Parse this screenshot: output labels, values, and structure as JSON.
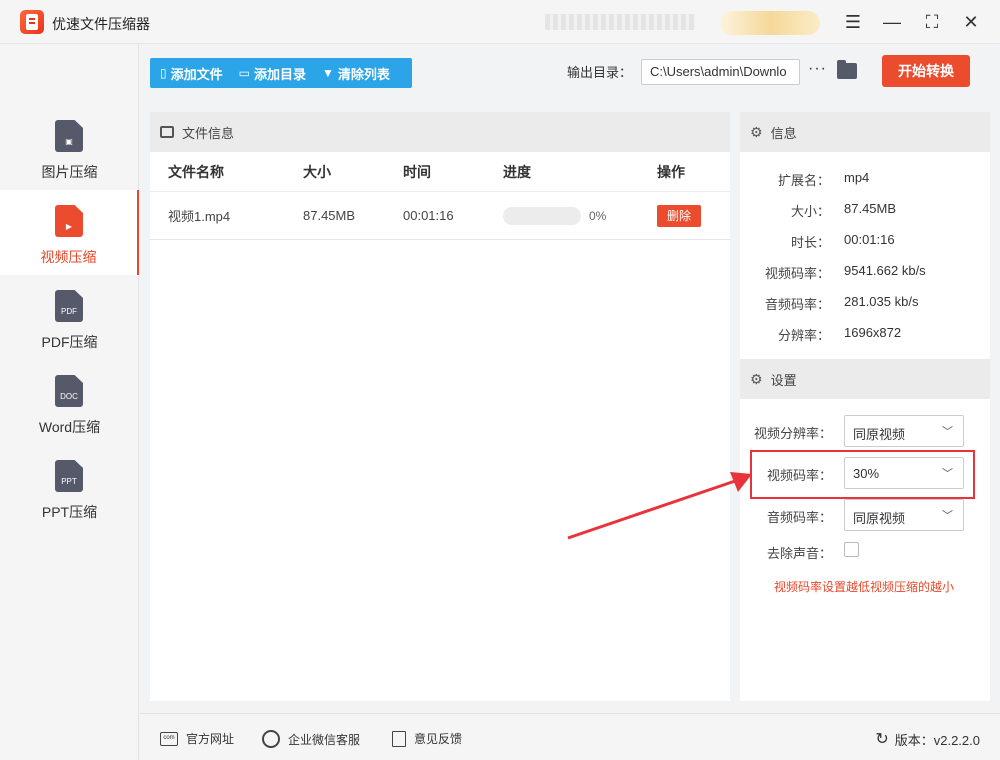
{
  "window": {
    "title": "优速文件压缩器",
    "min": "—",
    "max": "⛶",
    "close": "✕",
    "menu": "☰"
  },
  "sidebar": {
    "items": [
      {
        "label": "图片压缩",
        "icon_text": "▣"
      },
      {
        "label": "视频压缩",
        "icon_text": "▶"
      },
      {
        "label": "PDF压缩",
        "icon_text": "PDF"
      },
      {
        "label": "Word压缩",
        "icon_text": "DOC"
      },
      {
        "label": "PPT压缩",
        "icon_text": "PPT"
      }
    ]
  },
  "toolbar": {
    "add_file": "添加文件",
    "add_dir": "添加目录",
    "clear_list": "清除列表",
    "output_label": "输出目录：",
    "output_path": "C:\\Users\\admin\\Downlo",
    "dots": "···",
    "start": "开始转换"
  },
  "file_panel": {
    "title": "文件信息",
    "columns": [
      "文件名称",
      "大小",
      "时间",
      "进度",
      "操作"
    ],
    "rows": [
      {
        "name": "视频1.mp4",
        "size": "87.45MB",
        "time": "00:01:16",
        "progress_text": "0%",
        "progress": 0,
        "action": "删除"
      }
    ]
  },
  "info": {
    "title": "信息",
    "items": [
      {
        "k": "扩展名：",
        "v": "mp4"
      },
      {
        "k": "大小：",
        "v": "87.45MB"
      },
      {
        "k": "时长：",
        "v": "00:01:16"
      },
      {
        "k": "视频码率：",
        "v": "9541.662 kb/s"
      },
      {
        "k": "音频码率：",
        "v": "281.035 kb/s"
      },
      {
        "k": "分辨率：",
        "v": "1696x872"
      }
    ]
  },
  "settings": {
    "title": "设置",
    "resolution_label": "视频分辨率：",
    "resolution_value": "同原视频",
    "vbitrate_label": "视频码率：",
    "vbitrate_value": "30%",
    "abitrate_label": "音频码率：",
    "abitrate_value": "同原视频",
    "mute_label": "去除声音：",
    "hint": "视频码率设置越低视频压缩的越小"
  },
  "footer": {
    "website": "官方网址",
    "wechat": "企业微信客服",
    "feedback": "意见反馈",
    "version": "版本：v2.2.2.0"
  },
  "colors": {
    "accent": "#ea4c2d",
    "toolbar_blue": "#2ba5e8",
    "highlight_red": "#e8333a"
  }
}
